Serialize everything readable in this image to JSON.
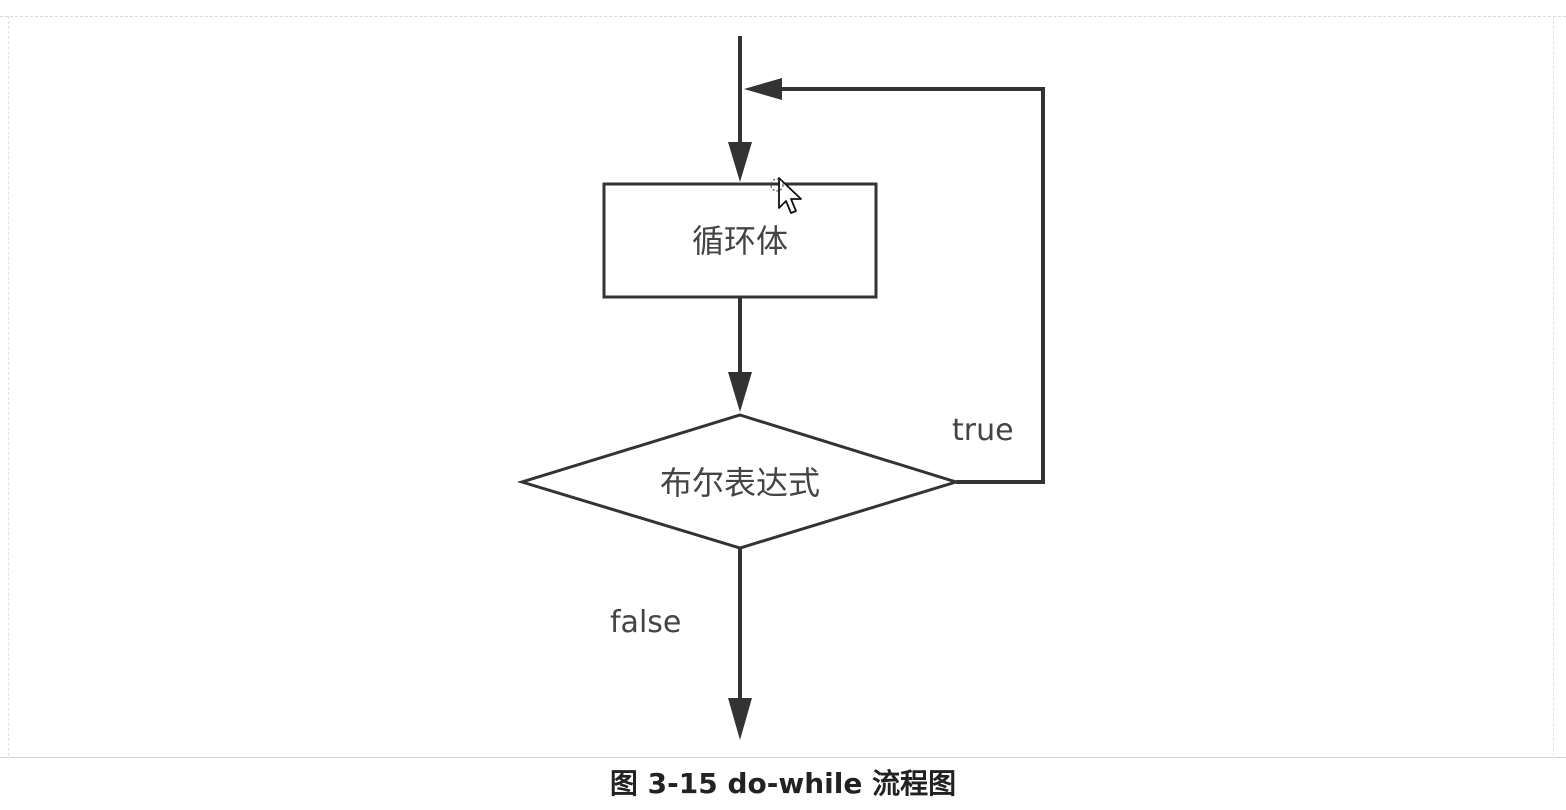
{
  "diagram": {
    "nodes": {
      "loop_body": {
        "label": "循环体"
      },
      "condition": {
        "label": "布尔表达式"
      }
    },
    "edges": {
      "true_label": "true",
      "false_label": "false"
    }
  },
  "caption": "图 3-15 do-while 流程图",
  "colors": {
    "stroke": "#333333",
    "text": "#444444"
  }
}
